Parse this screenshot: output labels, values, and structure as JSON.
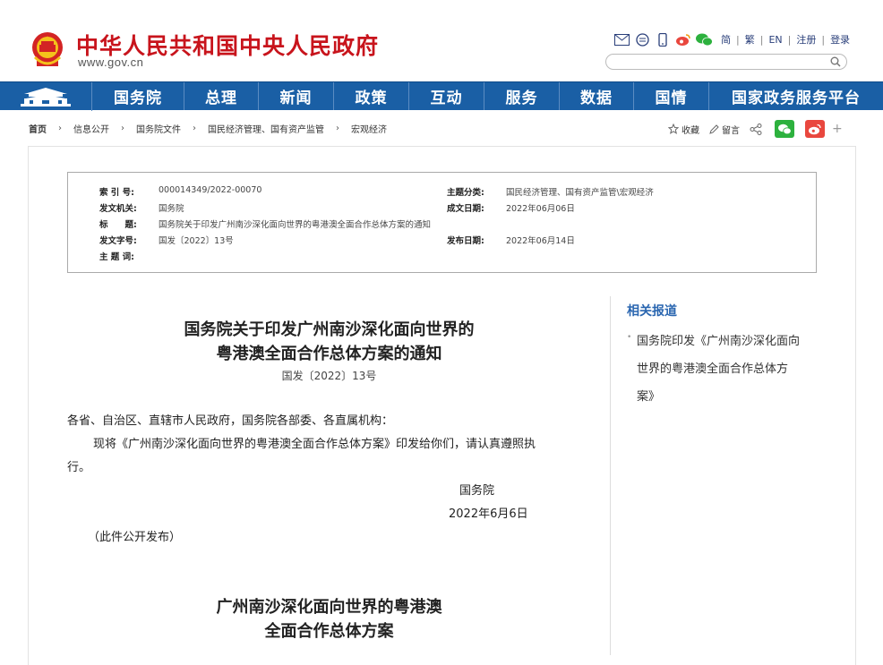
{
  "header": {
    "site_title": "中华人民共和国中央人民政府",
    "site_url": "www.gov.cn",
    "links": [
      "简",
      "繁",
      "EN",
      "注册",
      "登录"
    ],
    "search_placeholder": ""
  },
  "nav": {
    "items": [
      "国务院",
      "总理",
      "新闻",
      "政策",
      "互动",
      "服务",
      "数据",
      "国情",
      "国家政务服务平台"
    ]
  },
  "breadcrumb": [
    "首页",
    "信息公开",
    "国务院文件",
    "国民经济管理、国有资产监管",
    "宏观经济"
  ],
  "tools": {
    "favorite": "收藏",
    "comment": "留言"
  },
  "info": {
    "index_label": "索 引 号:",
    "index_value": "000014349/2022-00070",
    "category_label": "主题分类:",
    "category_value": "国民经济管理、国有资产监管\\宏观经济",
    "issuer_label": "发文机关:",
    "issuer_value": "国务院",
    "created_label": "成文日期:",
    "created_value": "2022年06月06日",
    "title_label": "标　　题:",
    "title_value": "国务院关于印发广州南沙深化面向世界的粤港澳全面合作总体方案的通知",
    "docno_label": "发文字号:",
    "docno_value": "国发〔2022〕13号",
    "published_label": "发布日期:",
    "published_value": "2022年06月14日",
    "keywords_label": "主 题 词:",
    "keywords_value": ""
  },
  "article": {
    "title_line1": "国务院关于印发广州南沙深化面向世界的",
    "title_line2": "粤港澳全面合作总体方案的通知",
    "doc_no": "国发〔2022〕13号",
    "salutation": "各省、自治区、直辖市人民政府，国务院各部委、各直属机构：",
    "body_line1": "现将《广州南沙深化面向世界的粤港澳全面合作总体方案》印发给你们，请认真遵照执",
    "body_line2": "行。",
    "signer": "国务院",
    "date": "2022年6月6日",
    "note": "（此件公开发布）",
    "sub_title_line1": "广州南沙深化面向世界的粤港澳",
    "sub_title_line2": "全面合作总体方案"
  },
  "related": {
    "title": "相关报道",
    "items": [
      {
        "line1": "国务院印发《广州南沙深化面向",
        "line2": "世界的粤港澳全面合作总体方",
        "line3": "案》"
      }
    ]
  },
  "colors": {
    "brand_red": "#c8141c",
    "nav_blue": "#1a5fa5",
    "link_blue": "#2a66b0"
  }
}
